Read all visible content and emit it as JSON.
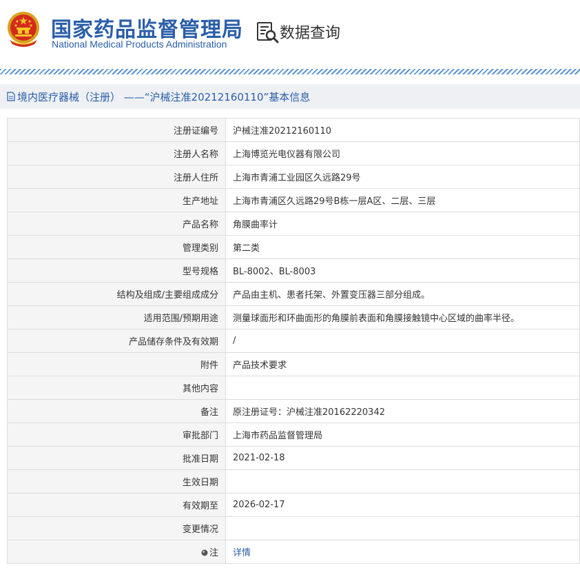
{
  "header": {
    "org_name_cn": "国家药品监督管理局",
    "org_name_en": "National Medical Products Administration",
    "query_title": "数据查询"
  },
  "breadcrumb": {
    "text": "境内医疗器械（注册） ——“沪械注准20212160110”基本信息"
  },
  "rows": [
    {
      "label": "注册证编号",
      "value": "沪械注准20212160110"
    },
    {
      "label": "注册人名称",
      "value": "上海博览光电仪器有限公司"
    },
    {
      "label": "注册人住所",
      "value": "上海市青浦工业园区久远路29号"
    },
    {
      "label": "生产地址",
      "value": "上海市青浦区久远路29号B栋一层A区、二层、三层"
    },
    {
      "label": "产品名称",
      "value": "角膜曲率计"
    },
    {
      "label": "管理类别",
      "value": "第二类"
    },
    {
      "label": "型号规格",
      "value": "BL-8002、BL-8003"
    },
    {
      "label": "结构及组成/主要组成成分",
      "value": "产品由主机、患者托架、外置变压器三部分组成。"
    },
    {
      "label": "适用范围/预期用途",
      "value": "测量球面形和环曲面形的角膜前表面和角膜接触镜中心区域的曲率半径。"
    },
    {
      "label": "产品储存条件及有效期",
      "value": "/"
    },
    {
      "label": "附件",
      "value": "产品技术要求"
    },
    {
      "label": "其他内容",
      "value": ""
    },
    {
      "label": "备注",
      "value": "原注册证号：沪械注准20162220342"
    },
    {
      "label": "审批部门",
      "value": "上海市药品监督管理局"
    },
    {
      "label": "批准日期",
      "value": "2021-02-18"
    },
    {
      "label": "生效日期",
      "value": ""
    },
    {
      "label": "有效期至",
      "value": "2026-02-17"
    },
    {
      "label": "变更情况",
      "value": ""
    }
  ],
  "note": {
    "label": "注",
    "link_text": "详情"
  },
  "colors": {
    "brand_blue": "#2a5ea8",
    "label_bg": "#f5f5f5",
    "crumb_bg": "#eef0f4"
  }
}
